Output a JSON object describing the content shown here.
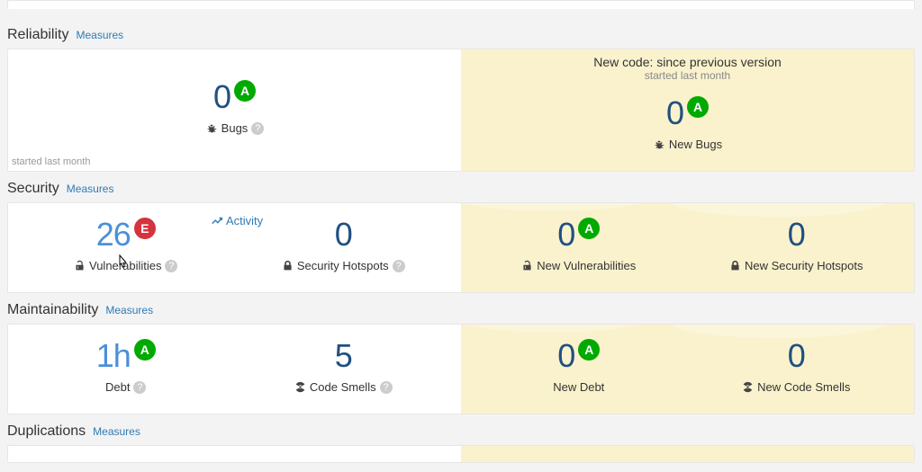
{
  "newcode_banner": {
    "line1": "New code: since previous version",
    "line2": "started last month"
  },
  "started_footer": "started last month",
  "measures_link": "Measures",
  "activity_link": "Activity",
  "sections": {
    "reliability": {
      "title": "Reliability",
      "left": {
        "value": "0",
        "rating": "A",
        "label": "Bugs",
        "icon": "bug",
        "help": true
      },
      "right": {
        "value": "0",
        "rating": "A",
        "label": "New Bugs",
        "icon": "bug",
        "help": false
      }
    },
    "security": {
      "title": "Security",
      "left1": {
        "value": "26",
        "rating": "E",
        "label": "Vulnerabilities",
        "icon": "lock-open",
        "help": true
      },
      "left2": {
        "value": "0",
        "label": "Security Hotspots",
        "icon": "lock",
        "help": true
      },
      "right1": {
        "value": "0",
        "rating": "A",
        "label": "New Vulnerabilities",
        "icon": "lock-open"
      },
      "right2": {
        "value": "0",
        "label": "New Security Hotspots",
        "icon": "lock"
      }
    },
    "maintainability": {
      "title": "Maintainability",
      "left1": {
        "value": "1h",
        "rating": "A",
        "label": "Debt",
        "help": true
      },
      "left2": {
        "value": "5",
        "label": "Code Smells",
        "icon": "radiation",
        "help": true
      },
      "right1": {
        "value": "0",
        "rating": "A",
        "label": "New Debt"
      },
      "right2": {
        "value": "0",
        "label": "New Code Smells",
        "icon": "radiation"
      }
    },
    "duplications": {
      "title": "Duplications"
    }
  }
}
